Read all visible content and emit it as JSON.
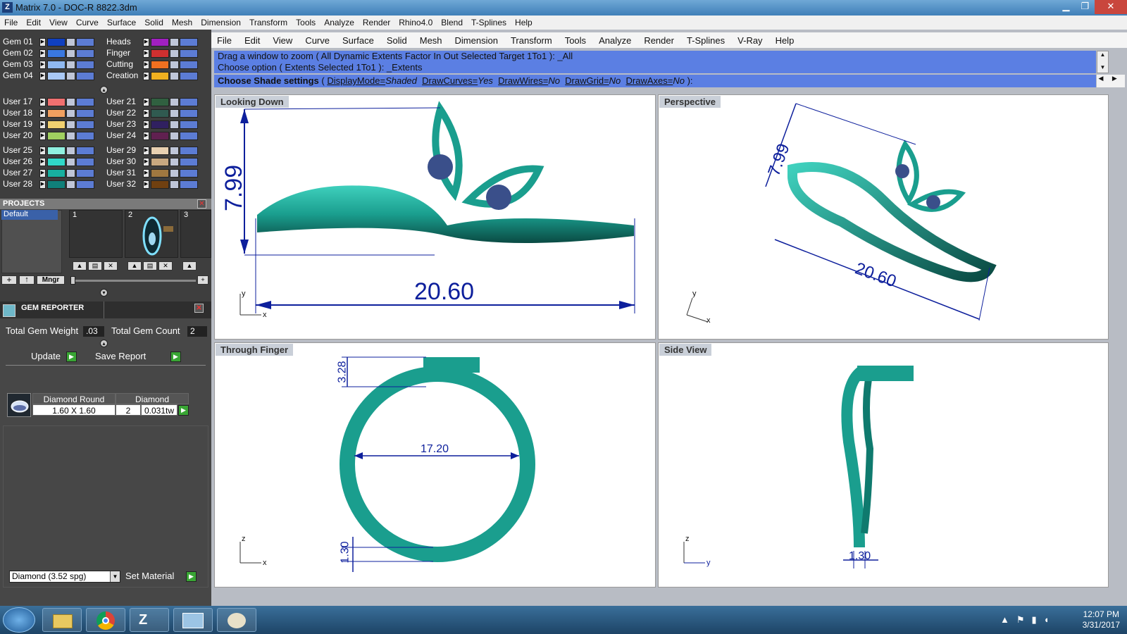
{
  "window": {
    "title": "Matrix 7.0 - DOC-R 8822.3dm",
    "app_icon": "Z",
    "minimize": "▁",
    "maximize": "❐",
    "close": "✕"
  },
  "menu_outer": [
    "File",
    "Edit",
    "View",
    "Curve",
    "Surface",
    "Solid",
    "Mesh",
    "Dimension",
    "Transform",
    "Tools",
    "Analyze",
    "Render",
    "Rhino4.0",
    "Blend",
    "T-Splines",
    "Help"
  ],
  "layers": {
    "left_col": [
      {
        "name": "Gem 01",
        "color": "#1040c0"
      },
      {
        "name": "Gem 02",
        "color": "#3a78e0"
      },
      {
        "name": "Gem 03",
        "color": "#8fb8f0"
      },
      {
        "name": "Gem 04",
        "color": "#a9c8f5"
      }
    ],
    "right_col": [
      {
        "name": "Heads",
        "color": "#a020c0"
      },
      {
        "name": "Finger",
        "color": "#d03030"
      },
      {
        "name": "Cutting",
        "color": "#f07020"
      },
      {
        "name": "Creation",
        "color": "#f0b020"
      }
    ],
    "user_left": [
      {
        "name": "User 17",
        "color": "#f07070"
      },
      {
        "name": "User 18",
        "color": "#f0a060"
      },
      {
        "name": "User 19",
        "color": "#f0d070"
      },
      {
        "name": "User 20",
        "color": "#a0d060"
      },
      {
        "name": "User 25",
        "color": "#90f0e0"
      },
      {
        "name": "User 26",
        "color": "#30d8c8"
      },
      {
        "name": "User 27",
        "color": "#18b0a0"
      },
      {
        "name": "User 28",
        "color": "#10807a"
      }
    ],
    "user_right": [
      {
        "name": "User 21",
        "color": "#306040"
      },
      {
        "name": "User 22",
        "color": "#305a50"
      },
      {
        "name": "User 23",
        "color": "#302060"
      },
      {
        "name": "User 24",
        "color": "#602050"
      },
      {
        "name": "User 29",
        "color": "#e8d0b0"
      },
      {
        "name": "User 30",
        "color": "#c8a880"
      },
      {
        "name": "User 31",
        "color": "#a07840"
      },
      {
        "name": "User 32",
        "color": "#704010"
      }
    ]
  },
  "projects": {
    "title": "PROJECTS",
    "selected": "Default",
    "thumbs": [
      "1",
      "2",
      "3"
    ],
    "buttons": {
      "add": "+",
      "up": "↑",
      "manager": "Mngr"
    }
  },
  "gem_reporter": {
    "title": "GEM REPORTER",
    "total_weight_label": "Total Gem Weight",
    "total_weight_value": ".03",
    "total_count_label": "Total Gem Count",
    "total_count_value": "2",
    "update_label": "Update",
    "save_report_label": "Save Report",
    "table": {
      "headers": [
        "Diamond Round",
        "Diamond"
      ],
      "row": {
        "size": "1.60 X 1.60",
        "count": "2",
        "weight": "0.031tw"
      }
    },
    "material_select": "Diamond     (3.52 spg)",
    "set_material_label": "Set Material"
  },
  "menu_inner": [
    "File",
    "Edit",
    "View",
    "Curve",
    "Surface",
    "Solid",
    "Mesh",
    "Dimension",
    "Transform",
    "Tools",
    "Analyze",
    "Render",
    "T-Splines",
    "V-Ray",
    "Help"
  ],
  "command": {
    "line1": "Drag a window to zoom ( All  Dynamic  Extents  Factor  In  Out  Selected  Target  1To1 ): _All",
    "line2": "Choose option ( Extents  Selected  1To1 ): _Extents",
    "prompt": "Choose Shade settings",
    "opt1": "DisplayMode=",
    "opt1v": "Shaded",
    "opt2": "DrawCurves=",
    "opt2v": "Yes",
    "opt3": "DrawWires=",
    "opt3v": "No",
    "opt4": "DrawGrid=",
    "opt4v": "No",
    "opt5": "DrawAxes=",
    "opt5v": "No"
  },
  "viewports": {
    "top_left": {
      "label": "Looking Down",
      "dim_height": "7.99",
      "dim_width": "20.60"
    },
    "top_right": {
      "label": "Perspective",
      "dim_height": "7.99",
      "dim_width": "20.60"
    },
    "bottom_left": {
      "label": "Through Finger",
      "dim_top": "3.28",
      "dim_inner": "17.20",
      "dim_bottom": "1.30"
    },
    "bottom_right": {
      "label": "Side View",
      "dim_bottom": "1.30"
    },
    "axis": {
      "x": "x",
      "y": "y",
      "z": "z"
    }
  },
  "colors": {
    "metal": "#1a9e8e",
    "metal_light": "#3fd0bd",
    "metal_dark": "#0a4a43",
    "dimension": "#0d1f9c",
    "gem": "#3a4f8a"
  },
  "taskbar": {
    "time": "12:07 PM",
    "date": "3/31/2017"
  }
}
